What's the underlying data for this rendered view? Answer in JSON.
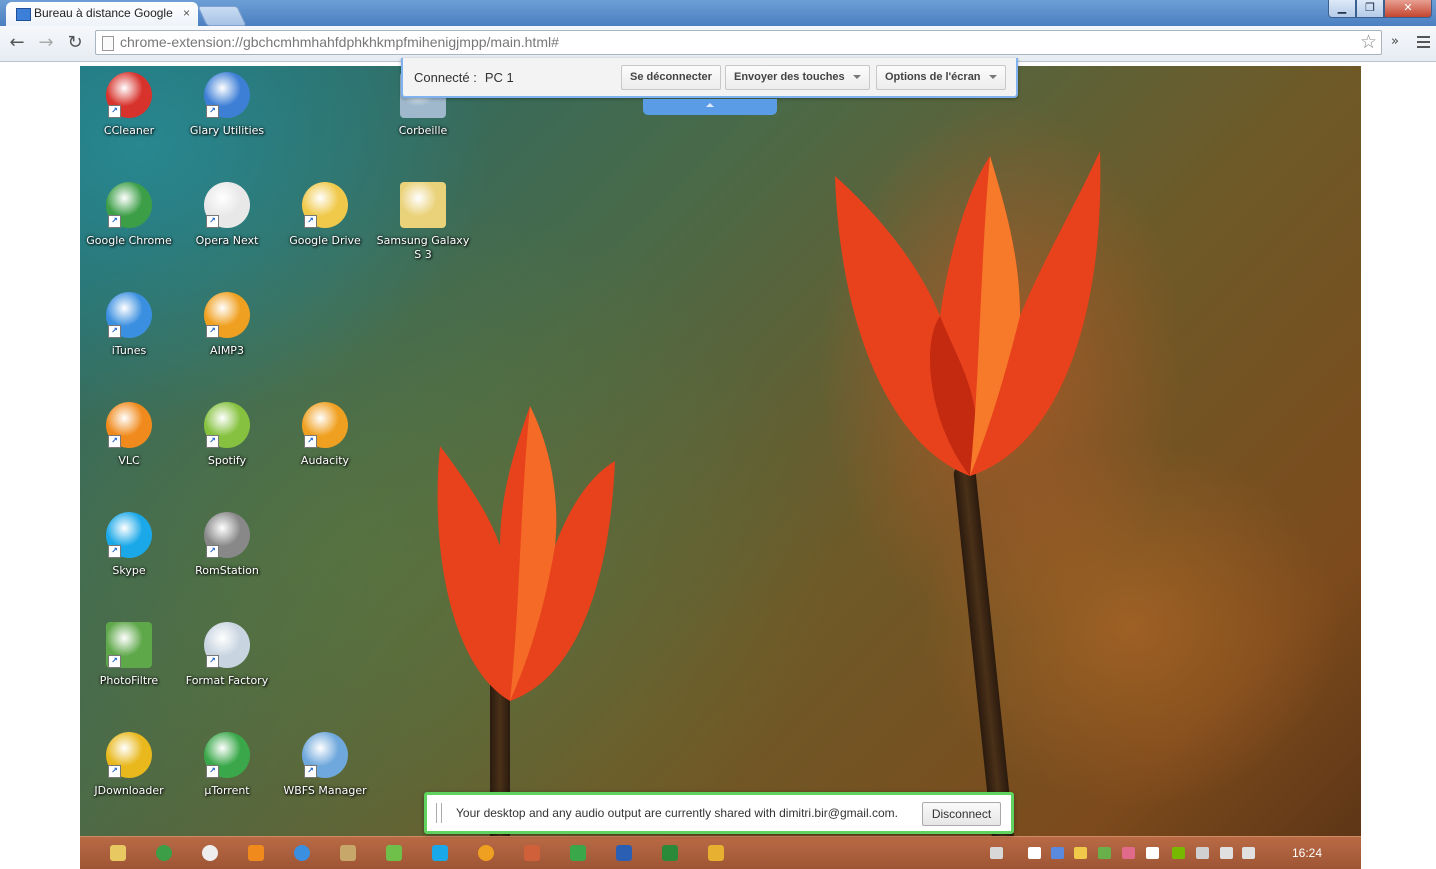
{
  "browser": {
    "tab_title": "Bureau à distance Google",
    "tab_close": "×",
    "url": "chrome-extension://gbchcmhmhahfdphkhkmpfmihenigjmpp/main.html#",
    "extensions_chevron": "»",
    "window_buttons": {
      "minimize": "▁",
      "restore": "❐",
      "close": "✕"
    }
  },
  "connection_bar": {
    "status_label": "Connecté :",
    "host_name": "PC 1",
    "disconnect_label": "Se déconnecter",
    "send_keys_label": "Envoyer des touches",
    "screen_options_label": "Options de l'écran"
  },
  "desktop_icons": [
    {
      "label": "CCleaner",
      "icon": "ccleaner-icon",
      "color": "#d7322b"
    },
    {
      "label": "Glary Utilities",
      "icon": "glary-utilities-icon",
      "color": "#3e7fd6"
    },
    {
      "label": "Corbeille",
      "icon": "recycle-bin-icon",
      "color": "#9fb8cc"
    },
    {
      "label": "Google Chrome",
      "icon": "chrome-icon",
      "color": "#3c9e47"
    },
    {
      "label": "Opera Next",
      "icon": "opera-icon",
      "color": "#e8e8e8"
    },
    {
      "label": "Google Drive",
      "icon": "google-drive-icon",
      "color": "#f0c94a"
    },
    {
      "label": "Samsung Galaxy S 3",
      "icon": "folder-icon",
      "color": "#ead27a"
    },
    {
      "label": "iTunes",
      "icon": "itunes-icon",
      "color": "#3a8fe0"
    },
    {
      "label": "AIMP3",
      "icon": "aimp-icon",
      "color": "#f0a020"
    },
    {
      "label": "VLC",
      "icon": "vlc-icon",
      "color": "#f08a1c"
    },
    {
      "label": "Spotify",
      "icon": "spotify-icon",
      "color": "#86c240"
    },
    {
      "label": "Audacity",
      "icon": "audacity-icon",
      "color": "#f0a020"
    },
    {
      "label": "Skype",
      "icon": "skype-icon",
      "color": "#1aa8e8"
    },
    {
      "label": "RomStation",
      "icon": "romstation-icon",
      "color": "#888888"
    },
    {
      "label": "PhotoFiltre",
      "icon": "photofiltre-icon",
      "color": "#5fa84a"
    },
    {
      "label": "Format Factory",
      "icon": "format-factory-icon",
      "color": "#c8d4e0"
    },
    {
      "label": "JDownloader",
      "icon": "jdownloader-icon",
      "color": "#e8b81c"
    },
    {
      "label": "µTorrent",
      "icon": "utorrent-icon",
      "color": "#3aa84a"
    },
    {
      "label": "WBFS Manager",
      "icon": "wbfs-manager-icon",
      "color": "#6fa8dc"
    }
  ],
  "taskbar": {
    "apps": [
      {
        "icon": "explorer-icon",
        "color": "#e8c860"
      },
      {
        "icon": "chrome-icon",
        "color": "#3c9e47"
      },
      {
        "icon": "opera-icon",
        "color": "#eeeeee"
      },
      {
        "icon": "vlc-icon",
        "color": "#f08a1c"
      },
      {
        "icon": "itunes-icon",
        "color": "#3a8fe0"
      },
      {
        "icon": "format-factory-icon",
        "color": "#c8a86a"
      },
      {
        "icon": "photofiltre-icon",
        "color": "#6fc04a"
      },
      {
        "icon": "skype-icon",
        "color": "#1aa8e8"
      },
      {
        "icon": "aimp-icon",
        "color": "#f0a020"
      },
      {
        "icon": "paint-icon",
        "color": "#d0603a"
      },
      {
        "icon": "utorrent-icon",
        "color": "#3aa84a"
      },
      {
        "icon": "word-icon",
        "color": "#2b5fb4"
      },
      {
        "icon": "excel-icon",
        "color": "#2a8a3a"
      },
      {
        "icon": "remote-desktop-icon",
        "color": "#e8b030"
      }
    ],
    "tray": [
      {
        "icon": "keyboard-icon",
        "color": "#d8d8d8"
      },
      {
        "icon": "cloud-icon",
        "color": "#ffffff"
      },
      {
        "icon": "people-icon",
        "color": "#5a8ae0"
      },
      {
        "icon": "google-drive-icon",
        "color": "#f0c94a"
      },
      {
        "icon": "security-icon",
        "color": "#6ab04a"
      },
      {
        "icon": "flower-icon",
        "color": "#e06a8a"
      },
      {
        "icon": "flag-icon",
        "color": "#ffffff"
      },
      {
        "icon": "nvidia-icon",
        "color": "#76b900"
      },
      {
        "icon": "power-icon",
        "color": "#d0d0d0"
      },
      {
        "icon": "network-icon",
        "color": "#e0e0e0"
      },
      {
        "icon": "volume-icon",
        "color": "#e0e0e0"
      }
    ],
    "clock": "16:24"
  },
  "share_notice": {
    "message": "Your desktop and any audio output are currently shared with dimitri.bir@gmail.com.",
    "disconnect_label": "Disconnect"
  }
}
